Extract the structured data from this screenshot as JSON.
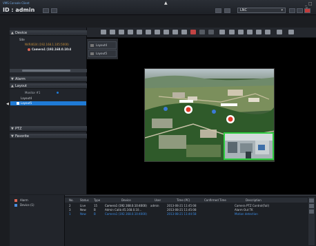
{
  "app": {
    "title": "VMS Console Client",
    "user": "ID : admin"
  },
  "layout_select": {
    "value": "LNC"
  },
  "panels": {
    "device": "Device",
    "site": "Site",
    "nvr": "NVR4024 (192.168.1.105:5000)",
    "camera": "Camera1 (192.168.0.10:4",
    "alarm": "Alarm",
    "layout": "Layout",
    "monitor": "Monitor #1",
    "layout4": "Layout4",
    "layout5": "Layout5",
    "ptz": "PTZ",
    "favorite": "Favorite"
  },
  "layout_list": [
    "Layout4",
    "Layout5"
  ],
  "bottom_left": [
    "Alarm",
    "Device (1)"
  ],
  "log": {
    "headers": [
      "No.",
      "Status",
      "Type",
      "Device",
      "User",
      "Time (PC)",
      "Confirmed Time",
      "Description"
    ],
    "rows": [
      [
        "2",
        "Live",
        "15",
        "Camera1 (192.168.0.10:4000)",
        "admin",
        "2013-08-21 11:45:08",
        "",
        "Camera PTZ Control(Fail)"
      ],
      [
        "3",
        "New",
        "B",
        "Admin Calib 45.168.0.10...",
        "",
        "2013-08-21 11:45:08",
        "",
        "Alarm Out TK"
      ],
      [
        "1",
        "New",
        "B",
        "Camera1 (192.168.0.10:4000)",
        "",
        "2013-08-21 11:44:58",
        "",
        "Motion detection"
      ]
    ]
  },
  "colors": {
    "accent": "#1f7bd6",
    "pip_border": "#2ecc40",
    "title_blue": "#6fa6e0"
  }
}
